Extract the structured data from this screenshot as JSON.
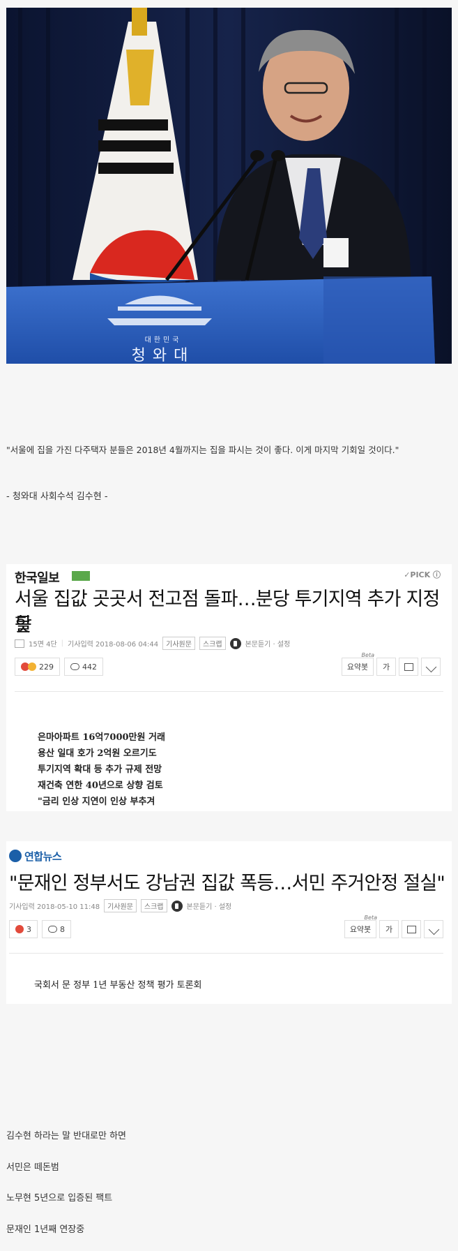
{
  "photo": {
    "podium_emblem_text": "대한민국",
    "podium_text": "청와대"
  },
  "quote": {
    "text": "\"서울에 집을 가진 다주택자 분들은 2018년 4월까지는 집을 파시는 것이 좋다. 이게 마지막 기회일 것이다.\"",
    "attribution": "- 청와대 사회수석 김수현 -"
  },
  "article1": {
    "brand": "한국일보",
    "pick_label": "✓PICK ⓘ",
    "headline_line1": "서울 집값 곳곳서 전고점 돌파…분당 투기지역 추가 지정할",
    "headline_line2": "듯",
    "page_info": "15면 4단",
    "date_label": "기사입력 2018-08-06 04:44",
    "original_btn": "기사원문",
    "scrap_btn": "스크랩",
    "listen_label": "본문듣기 · 설정",
    "reaction_count": "229",
    "comment_count": "442",
    "summary_btn": "요약봇",
    "beta_label": "Beta",
    "font_btn": "가",
    "subheads": [
      "은마아파트 16억7000만원 거래",
      "용산 일대 호가 2억원 오르기도",
      "투기지역 확대 등 추가 규제 전망",
      "재건축 연한 40년으로 상향 검토",
      "\"금리 인상 지연이 인상 부추겨"
    ]
  },
  "article2": {
    "brand": "연합뉴스",
    "headline": "\"문재인 정부서도 강남권 집값 폭등…서민 주거안정 절실\"",
    "date_label": "기사입력 2018-05-10 11:48",
    "original_btn": "기사원문",
    "scrap_btn": "스크랩",
    "listen_label": "본문듣기 · 설정",
    "reaction_count": "3",
    "comment_count": "8",
    "summary_btn": "요약봇",
    "beta_label": "Beta",
    "font_btn": "가",
    "subhead": "국회서 문 정부 1년 부동산 정책 평가 토론회"
  },
  "closing": [
    "김수현 하라는 말 반대로만 하면",
    "서민은 떼돈범",
    "노무현 5년으로 입증된 팩트",
    "문재인 1년째 연장중"
  ],
  "colors": {
    "background": "#f6f6f6",
    "hankook_brand": "#1a1a1a",
    "yonhap_brand": "#1b5fa8",
    "podium_blue": "#2b5bb5"
  }
}
